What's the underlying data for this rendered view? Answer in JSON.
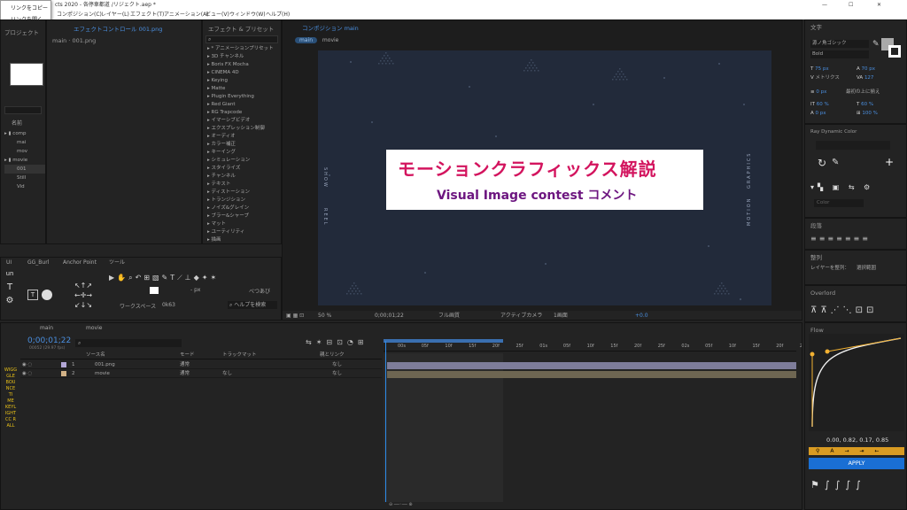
{
  "window": {
    "title": "cts 2020 - 各停車都道 /リジェクト.aep *",
    "context_menu": [
      "リンクをコピー",
      "リンクを開く"
    ],
    "controls": [
      "—",
      "☐",
      "✕"
    ]
  },
  "menubar": [
    "コンポジション(C)",
    "レイヤー(L)",
    "エフェクト(T)",
    "アニメーション(A)",
    "ビュー(V)",
    "ウィンドウ(W)",
    "ヘルプ(H)"
  ],
  "project": {
    "label": "プロジェクト",
    "comp_label": "main · 001.png",
    "search_placeholder": "",
    "col_name": "名前",
    "items": [
      {
        "name": "comp",
        "type": "folder"
      },
      {
        "name": "mai",
        "type": "comp"
      },
      {
        "name": "mov",
        "type": "comp"
      },
      {
        "name": "movie",
        "type": "folder"
      },
      {
        "name": "001",
        "type": "file"
      },
      {
        "name": "Still",
        "type": "file"
      },
      {
        "name": "Vid",
        "type": "file"
      }
    ]
  },
  "effect_controls": {
    "tab": "エフェクトコントロール 001.png",
    "sub": "main · 001.png"
  },
  "effects": {
    "tab": "エフェクト & プリセット",
    "search_placeholder": "",
    "items": [
      "* アニメーションプリセット",
      "3D チャンネル",
      "Boris FX Mocha",
      "CINEMA 4D",
      "Keying",
      "Matte",
      "Plugin Everything",
      "Red Giant",
      "RG Trapcode",
      "イマーシブビデオ",
      "エクスプレッション制御",
      "オーディオ",
      "カラー補正",
      "キーイング",
      "シミュレーション",
      "スタイライズ",
      "チャンネル",
      "テキスト",
      "ディストーション",
      "トランジション",
      "ノイズ&グレイン",
      "ブラー&シャープ",
      "マット",
      "ユーティリティ",
      "描画"
    ]
  },
  "comp_viewer": {
    "tab": "コンポジション main",
    "breadcrumbs": [
      "main",
      "movie"
    ],
    "title": "モーションクラフィックス解説",
    "subtitle": "Visual Image contest コメント",
    "side_left": [
      "SHOW",
      "REEL"
    ],
    "side_right": [
      "GRAPHICS",
      "MOTION"
    ],
    "zoom": "50 %",
    "timecode": "0;00;01;22",
    "resolution": "フル画質",
    "camera": "アクティブカメラ",
    "views": "1画面",
    "offset": "+0.0"
  },
  "tools": {
    "tabs": [
      "UI",
      "GG_Burl",
      "Anchor Point",
      "ツール"
    ],
    "workspace": "ワークスペース",
    "workspace_value": "0k63",
    "help_placeholder": "ヘルプを検索",
    "auto_open": "べつあび",
    "px": "- px"
  },
  "timeline": {
    "tabs": [
      "main",
      "movie"
    ],
    "timecode": "0;00;01;22",
    "frames": "00052 (29.97 fps)",
    "col_source": "ソース名",
    "col_mode": "モード",
    "col_trkmat": "トラックマット",
    "col_parent": "親とリンク",
    "layers": [
      {
        "num": "1",
        "name": "001.png",
        "mode": "通常",
        "trk": "",
        "parent": "なし",
        "color": "#b3a7d6"
      },
      {
        "num": "2",
        "name": "movie",
        "mode": "通常",
        "trk": "なし",
        "parent": "なし",
        "color": "#d2b287"
      }
    ],
    "ruler": [
      "00s",
      "05f",
      "10f",
      "15f",
      "20f",
      "25f",
      "01s",
      "05f",
      "10f",
      "15f",
      "20f",
      "25f",
      "02s",
      "05f",
      "10f",
      "15f",
      "20f",
      "25f",
      "03s"
    ],
    "left_labels": [
      "WIGG",
      "GLE",
      "BOU",
      "NCE",
      "TI",
      "ME",
      "KEYL",
      "IGHT",
      "CC R",
      "ALL"
    ]
  },
  "character": {
    "tab": "文字",
    "font": "源ノ角ゴシック",
    "style": "Bold",
    "size": "75 px",
    "leading": "70 px",
    "kern": "メトリクス",
    "track": "127",
    "indent": "0 px",
    "vscale": "60 %",
    "hscale": "60 %",
    "baseline": "0 px",
    "tsume": "100 %",
    "align": "最初の上に揃え"
  },
  "ray_color": {
    "tab": "Ray Dynamic Color",
    "select": "Color"
  },
  "paragraph": {
    "tab": "段落"
  },
  "align_panel": {
    "tab": "整列",
    "label": "レイヤーを整列：",
    "value": "選択範囲"
  },
  "overlord": {
    "tab": "Overlord"
  },
  "flow": {
    "tab": "Flow",
    "values": "0.00, 0.82, 0.17, 0.85",
    "apply": "APPLY",
    "curve": [
      0.0,
      0.82,
      0.17,
      0.85
    ]
  },
  "colors": {
    "accent": "#2d8ceb",
    "apply_bg": "#1a6fd4",
    "flow_curve": "#f2b132",
    "timeline_bar": "#7e7d9a"
  }
}
